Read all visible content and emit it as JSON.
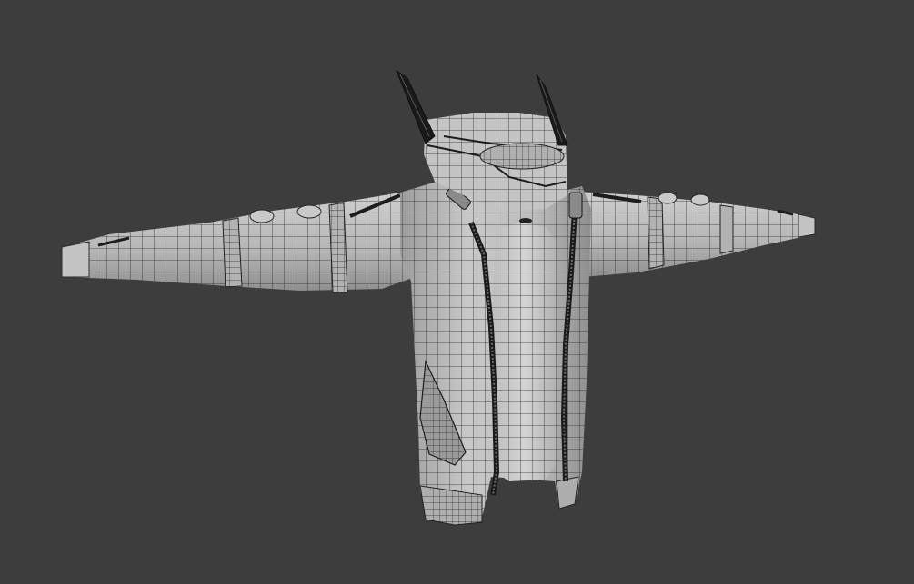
{
  "viewport": {
    "background_color": "#3d3d3d",
    "object": "jacket-wireframe-mesh",
    "display_mode": "solid-with-wireframe",
    "mesh_color": "#b9b9b9",
    "wire_color": "#2a2a2a"
  }
}
